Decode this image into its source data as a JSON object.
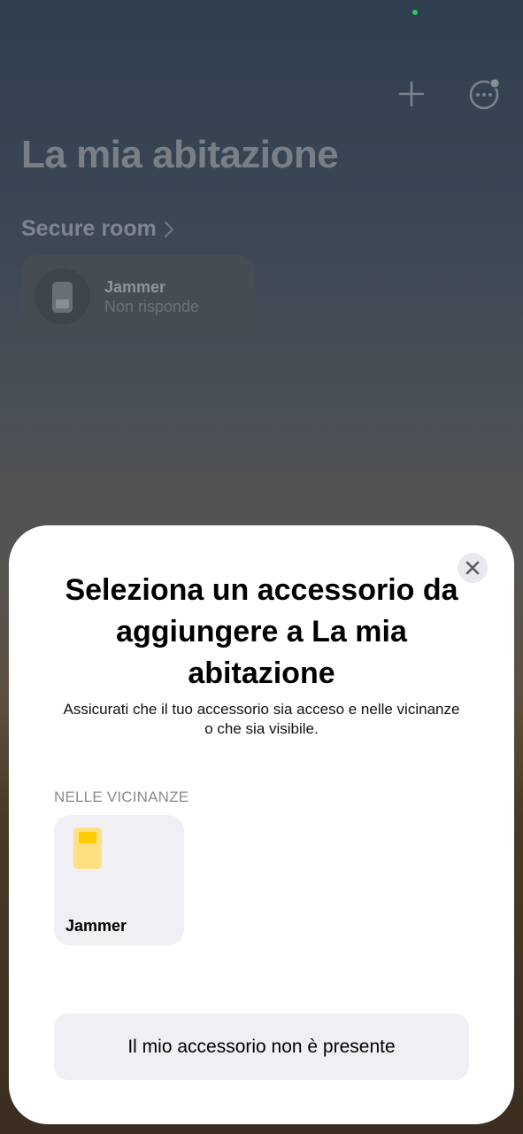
{
  "home": {
    "title": "La mia abitazione",
    "room_name": "Secure room",
    "accessory_tile": {
      "name": "Jammer",
      "status": "Non risponde"
    },
    "add_icon": "plus-icon",
    "more_icon": "ellipsis-circle-icon"
  },
  "sheet": {
    "title": "Seleziona un accessorio da aggiungere a La mia abitazione",
    "subtitle": "Assicurati che il tuo accessorio sia acceso e nelle vicinanze o che sia visibile.",
    "section_label": "NELLE VICINANZE",
    "accessories": [
      {
        "name": "Jammer",
        "icon": "device-icon",
        "accent": "#FFCC00"
      }
    ],
    "not_present_label": "Il mio accessorio non è presente",
    "close_icon": "close-icon"
  }
}
